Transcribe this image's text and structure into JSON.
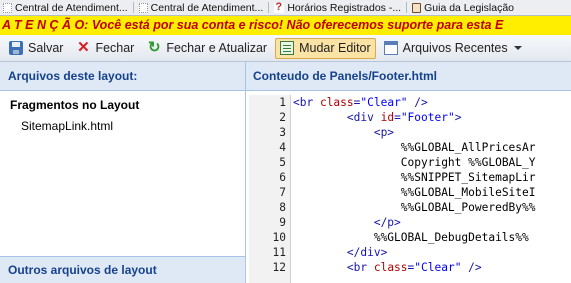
{
  "tabs": [
    {
      "label": "Central de Atendiment...",
      "icon": "tab-page-icon"
    },
    {
      "label": "Central de Atendiment...",
      "icon": "tab-page-icon"
    },
    {
      "label": "Horários Registrados -...",
      "icon": "tab-help-icon"
    },
    {
      "label": "Guia da Legislação",
      "icon": "tab-book-icon"
    }
  ],
  "banner": {
    "text": "A T E N Ç Ã O: Você está por sua conta e risco! Não oferecemos suporte para esta E",
    "color": "#c00000",
    "background": "#ffee00"
  },
  "toolbar": {
    "save": "Salvar",
    "close": "Fechar",
    "close_refresh": "Fechar e Atualizar",
    "change_editor": "Mudar Editor",
    "recent_files": "Arquivos Recentes"
  },
  "left_panel": {
    "header": "Arquivos deste layout:",
    "section_title": "Fragmentos no Layout",
    "files": [
      "SitemapLink.html"
    ],
    "bottom_header": "Outros arquivos de layout"
  },
  "editor": {
    "header": "Conteudo de Panels/Footer.html",
    "line_numbers": [
      "1",
      "2",
      "3",
      "4",
      "5",
      "6",
      "7",
      "8",
      "9",
      "10",
      "11",
      "12"
    ],
    "lines": [
      {
        "indent": "",
        "parts": [
          {
            "t": "tag",
            "v": "<br "
          },
          {
            "t": "attr",
            "v": "class"
          },
          {
            "t": "tag",
            "v": "="
          },
          {
            "t": "val",
            "v": "\"Clear\""
          },
          {
            "t": "tag",
            "v": " />"
          }
        ]
      },
      {
        "indent": "        ",
        "parts": [
          {
            "t": "tag",
            "v": "<div "
          },
          {
            "t": "attr",
            "v": "id"
          },
          {
            "t": "tag",
            "v": "="
          },
          {
            "t": "val",
            "v": "\"Footer\""
          },
          {
            "t": "tag",
            "v": ">"
          }
        ]
      },
      {
        "indent": "            ",
        "parts": [
          {
            "t": "tag",
            "v": "<p>"
          }
        ]
      },
      {
        "indent": "                ",
        "parts": [
          {
            "t": "text",
            "v": "%%GLOBAL_AllPricesAr"
          }
        ]
      },
      {
        "indent": "                ",
        "parts": [
          {
            "t": "text",
            "v": "Copyright %%GLOBAL_Y"
          }
        ]
      },
      {
        "indent": "                ",
        "parts": [
          {
            "t": "text",
            "v": "%%SNIPPET_SitemapLir"
          }
        ]
      },
      {
        "indent": "                ",
        "parts": [
          {
            "t": "text",
            "v": "%%GLOBAL_MobileSiteI"
          }
        ]
      },
      {
        "indent": "                ",
        "parts": [
          {
            "t": "text",
            "v": "%%GLOBAL_PoweredBy%%"
          }
        ]
      },
      {
        "indent": "            ",
        "parts": [
          {
            "t": "tag",
            "v": "</p>"
          }
        ]
      },
      {
        "indent": "            ",
        "parts": [
          {
            "t": "text",
            "v": "%%GLOBAL_DebugDetails%%"
          }
        ]
      },
      {
        "indent": "        ",
        "parts": [
          {
            "t": "tag",
            "v": "</div>"
          }
        ]
      },
      {
        "indent": "        ",
        "parts": [
          {
            "t": "tag",
            "v": "<br "
          },
          {
            "t": "attr",
            "v": "class"
          },
          {
            "t": "tag",
            "v": "="
          },
          {
            "t": "val",
            "v": "\"Clear\""
          },
          {
            "t": "tag",
            "v": " />"
          }
        ]
      }
    ]
  }
}
